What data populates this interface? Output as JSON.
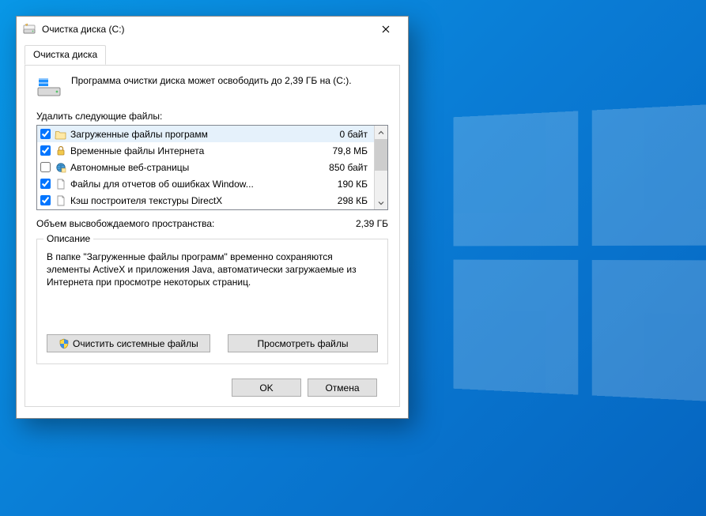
{
  "window": {
    "title": "Очистка диска  (C:)"
  },
  "tabs": {
    "cleanup": "Очистка диска"
  },
  "summary": {
    "text": "Программа очистки диска может освободить до 2,39 ГБ на (C:)."
  },
  "labels": {
    "delete_following": "Удалить следующие файлы:",
    "freed_label": "Объем высвобождаемого пространства:",
    "freed_value": "2,39 ГБ",
    "description_legend": "Описание"
  },
  "description": {
    "text": "В папке \"Загруженные файлы программ\" временно сохраняются элементы ActiveX и приложения Java, автоматически загружаемые из Интернета при просмотре некоторых страниц."
  },
  "buttons": {
    "clean_system": "Очистить системные файлы",
    "view_files": "Просмотреть файлы",
    "ok": "OK",
    "cancel": "Отмена"
  },
  "files": [
    {
      "checked": true,
      "icon": "folder",
      "name": "Загруженные файлы программ",
      "size": "0 байт",
      "selected": true
    },
    {
      "checked": true,
      "icon": "lock",
      "name": "Временные файлы Интернета",
      "size": "79,8 МБ",
      "selected": false
    },
    {
      "checked": false,
      "icon": "globe",
      "name": "Автономные веб-страницы",
      "size": "850 байт",
      "selected": false
    },
    {
      "checked": true,
      "icon": "page",
      "name": "Файлы для отчетов об ошибках Window...",
      "size": "190 КБ",
      "selected": false
    },
    {
      "checked": true,
      "icon": "page",
      "name": "Кэш построителя текстуры DirectX",
      "size": "298 КБ",
      "selected": false
    }
  ]
}
